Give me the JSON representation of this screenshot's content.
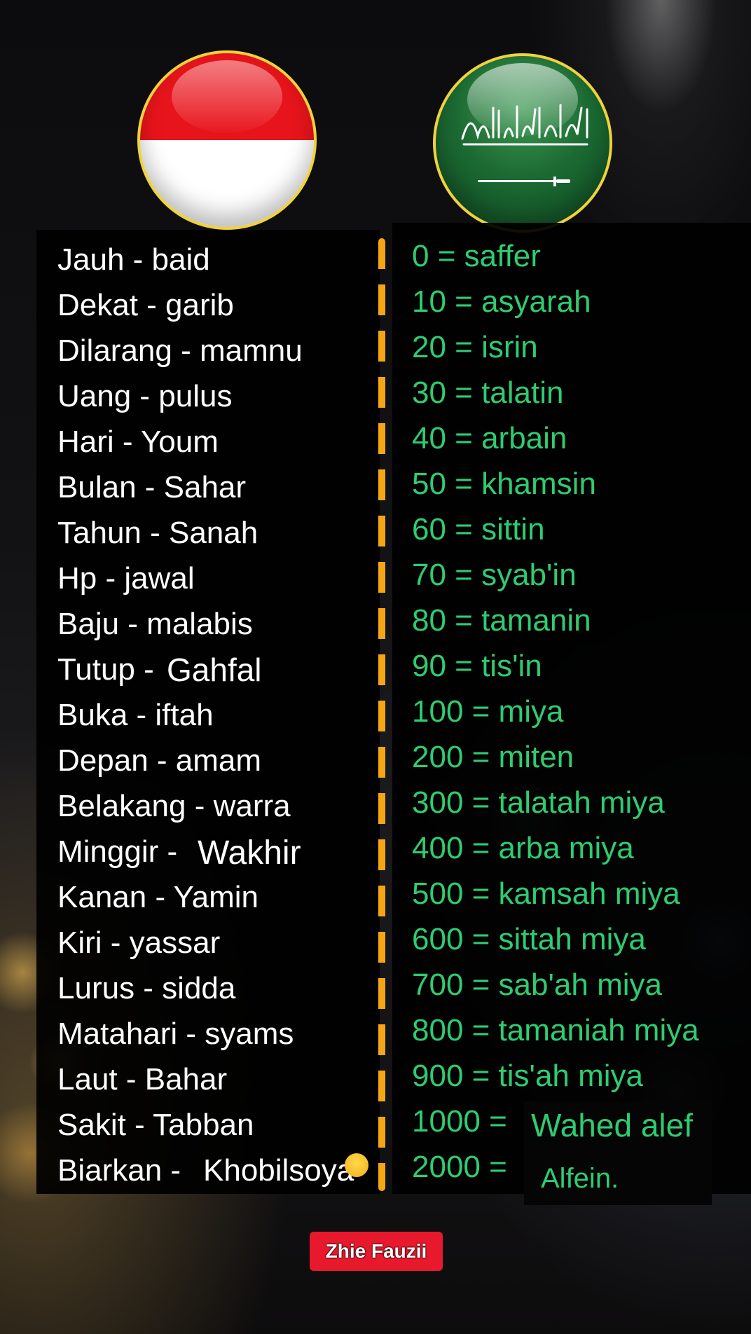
{
  "vocab_left": [
    "Jauh - baid",
    "Dekat - garib",
    "Dilarang - mamnu",
    "Uang - pulus",
    "Hari - Youm",
    "Bulan - Sahar",
    "Tahun - Sanah",
    "Hp - jawal",
    "Baju - malabis",
    "Tutup -",
    "Buka - iftah",
    "Depan - amam",
    "Belakang - warra",
    "Minggir -",
    "Kanan - Yamin",
    "Kiri - yassar",
    "Lurus - sidda",
    "Matahari - syams",
    "Laut - Bahar",
    "Sakit - Tabban",
    "Biarkan -"
  ],
  "numbers_right": [
    "0 = saffer",
    "10 = asyarah",
    "20 = isrin",
    "30 = talatin",
    "40 = arbain",
    "50 = khamsin",
    "60 = sittin",
    "70 = syab'in",
    "80 = tamanin",
    "90 = tis'in",
    "100 = miya",
    "200 = miten",
    "300 = talatah miya",
    "400 = arba miya",
    "500 = kamsah miya",
    "600 = sittah miya",
    "700 = sab'ah miya",
    "800 = tamaniah miya",
    "900 = tis'ah miya",
    "1000 =",
    "2000 ="
  ],
  "overlays": {
    "tutup_word": "Gahfal",
    "minggir_word": "Wakhir",
    "biarkan_word": "Khobilsoya",
    "thousand_word": "Wahed alef",
    "two_thousand_word": "Alfein."
  },
  "credit": "Zhie Fauzii",
  "flags": {
    "left": "indonesia-flag",
    "right": "saudi-arabia-flag",
    "colors": {
      "red": "#e8141b",
      "white": "#ffffff",
      "green": "#1c6b33",
      "gold_border": "#f0d23a"
    }
  },
  "colors": {
    "left_text": "#ffffff",
    "right_text": "#2ecc71",
    "divider": "#f5a615",
    "credit_bg": "#e8192c"
  }
}
